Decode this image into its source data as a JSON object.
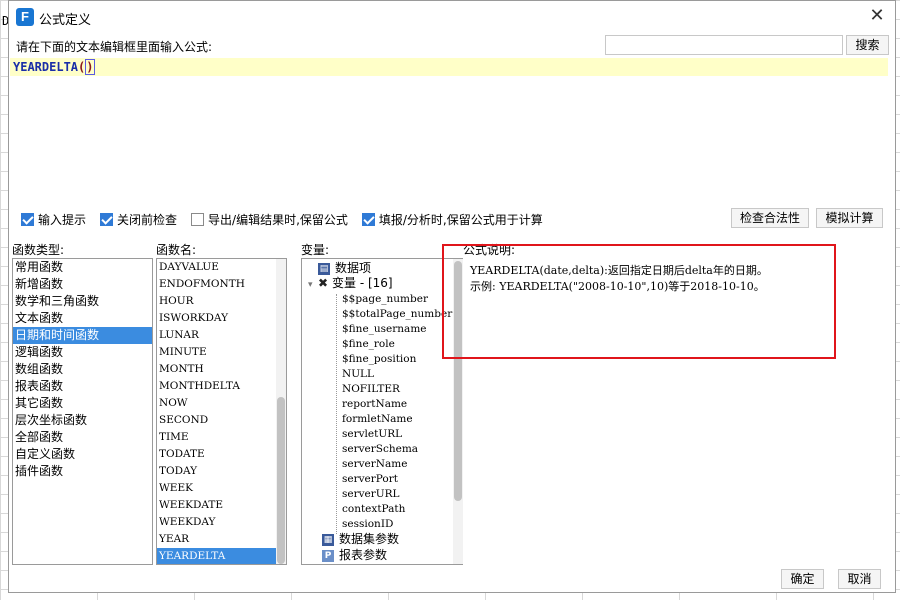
{
  "dialog": {
    "title": "公式定义",
    "app_icon_glyph": "F",
    "close_glyph": "✕",
    "prompt": "请在下面的文本编辑框里面输入公式:",
    "search": {
      "value": "",
      "button_label": "搜索"
    },
    "editor": {
      "func": "YEARDELTA",
      "open": "(",
      "close": ")"
    },
    "options": [
      {
        "label": "输入提示",
        "checked": true
      },
      {
        "label": "关闭前检查",
        "checked": true
      },
      {
        "label": "导出/编辑结果时,保留公式",
        "checked": false
      },
      {
        "label": "填报/分析时,保留公式用于计算",
        "checked": true
      }
    ],
    "check_button": "检查合法性",
    "simulate_button": "模拟计算",
    "labels": {
      "category": "函数类型:",
      "function": "函数名:",
      "variable": "变量:",
      "description": "公式说明:"
    },
    "categories": [
      "常用函数",
      "新增函数",
      "数学和三角函数",
      "文本函数",
      "日期和时间函数",
      "逻辑函数",
      "数组函数",
      "报表函数",
      "其它函数",
      "层次坐标函数",
      "全部函数",
      "自定义函数",
      "插件函数"
    ],
    "selected_category": "日期和时间函数",
    "functions": [
      "DAYVALUE",
      "ENDOFMONTH",
      "HOUR",
      "ISWORKDAY",
      "LUNAR",
      "MINUTE",
      "MONTH",
      "MONTHDELTA",
      "NOW",
      "SECOND",
      "TIME",
      "TODATE",
      "TODAY",
      "WEEK",
      "WEEKDATE",
      "WEEKDAY",
      "YEAR",
      "YEARDELTA"
    ],
    "selected_function": "YEARDELTA",
    "variables": {
      "data_items": "数据项",
      "group_label": "变量 - [16]",
      "items": [
        "$$page_number",
        "$$totalPage_number",
        "$fine_username",
        "$fine_role",
        "$fine_position",
        "NULL",
        "NOFILTER",
        "reportName",
        "formletName",
        "servletURL",
        "serverSchema",
        "serverName",
        "serverPort",
        "serverURL",
        "contextPath",
        "sessionID"
      ],
      "dataset_params": "数据集参数",
      "report_params": "报表参数",
      "report_params_icon": "P"
    },
    "description": {
      "line1": "YEARDELTA(date,delta):返回指定日期后delta年的日期。",
      "line2": "示例: YEARDELTA(\"2008-10-10\",10)等于2018-10-10。"
    },
    "ok_button": "确定",
    "cancel_button": "取消"
  },
  "sheet": {
    "cell_letter": "D"
  },
  "colors": {
    "accent": "#3b8ce0",
    "highlight": "#e0151b",
    "editor_bg": "#ffffc8"
  }
}
